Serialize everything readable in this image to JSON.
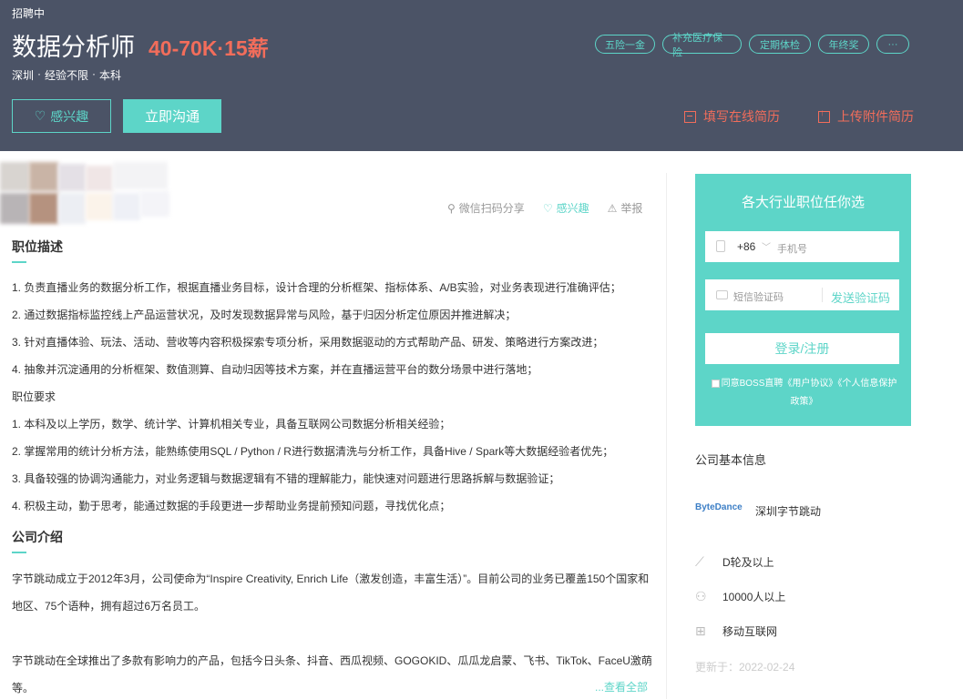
{
  "header": {
    "status": "招聘中",
    "job_title": "数据分析师",
    "salary": "40-70K·15薪",
    "meta": [
      "深圳",
      "·",
      "经验不限",
      "·",
      "本科"
    ],
    "tags": [
      "五险一金",
      "补充医疗保险",
      "定期体检",
      "年终奖",
      "···"
    ],
    "interest_label": "感兴趣",
    "chat_label": "立即沟通",
    "fill_resume_label": "填写在线简历",
    "upload_resume_label": "上传附件简历"
  },
  "actions": {
    "share_label": "微信扫码分享",
    "interest_label": "感兴趣",
    "report_label": "举报"
  },
  "job": {
    "desc_title": "职位描述",
    "lines": [
      "1. 负责直播业务的数据分析工作，根据直播业务目标，设计合理的分析框架、指标体系、A/B实验，对业务表现进行准确评估；",
      "2. 通过数据指标监控线上产品运营状况，及时发现数据异常与风险，基于归因分析定位原因并推进解决；",
      "3. 针对直播体验、玩法、活动、营收等内容积极探索专项分析，采用数据驱动的方式帮助产品、研发、策略进行方案改进；",
      "4. 抽象并沉淀通用的分析框架、数值测算、自动归因等技术方案，并在直播运营平台的数分场景中进行落地；",
      "职位要求",
      "1. 本科及以上学历，数学、统计学、计算机相关专业，具备互联网公司数据分析相关经验；",
      "2. 掌握常用的统计分析方法，能熟练使用SQL / Python / R进行数据清洗与分析工作，具备Hive / Spark等大数据经验者优先；",
      "3. 具备较强的协调沟通能力，对业务逻辑与数据逻辑有不错的理解能力，能快速对问题进行思路拆解与数据验证；",
      "4. 积极主动，勤于思考，能通过数据的手段更进一步帮助业务提前预知问题，寻找优化点；"
    ],
    "company_title": "公司介绍",
    "company_lines": [
      "字节跳动成立于2012年3月，公司使命为“Inspire Creativity, Enrich Life（激发创造，丰富生活）”。目前公司的业务已覆盖150个国家和",
      "地区、75个语种，拥有超过6万名员工。",
      "字节跳动在全球推出了多款有影响力的产品，包括今日头条、抖音、西瓜视频、GOGOKID、瓜瓜龙启蒙、飞书、TikTok、FaceU激萌",
      "等。"
    ],
    "see_all": "...查看全部"
  },
  "login": {
    "title": "各大行业职位任你选",
    "country_code": "+86",
    "phone_placeholder": "手机号",
    "code_placeholder": "短信验证码",
    "send_code": "发送验证码",
    "submit": "登录/注册",
    "agree_line1": "同意BOSS直聘《用户协议》《个人信息保护",
    "agree_line2": "政策》"
  },
  "company": {
    "section_title": "公司基本信息",
    "logo_text": "ByteDance",
    "name": "深圳字节跳动",
    "stage": "D轮及以上",
    "size": "10000人以上",
    "industry": "移动互联网",
    "updated": "更新于：2022-02-24"
  },
  "colors": {
    "header_bg": "#4b5366",
    "accent": "#5dd5c8",
    "salary": "#f26d5b"
  }
}
